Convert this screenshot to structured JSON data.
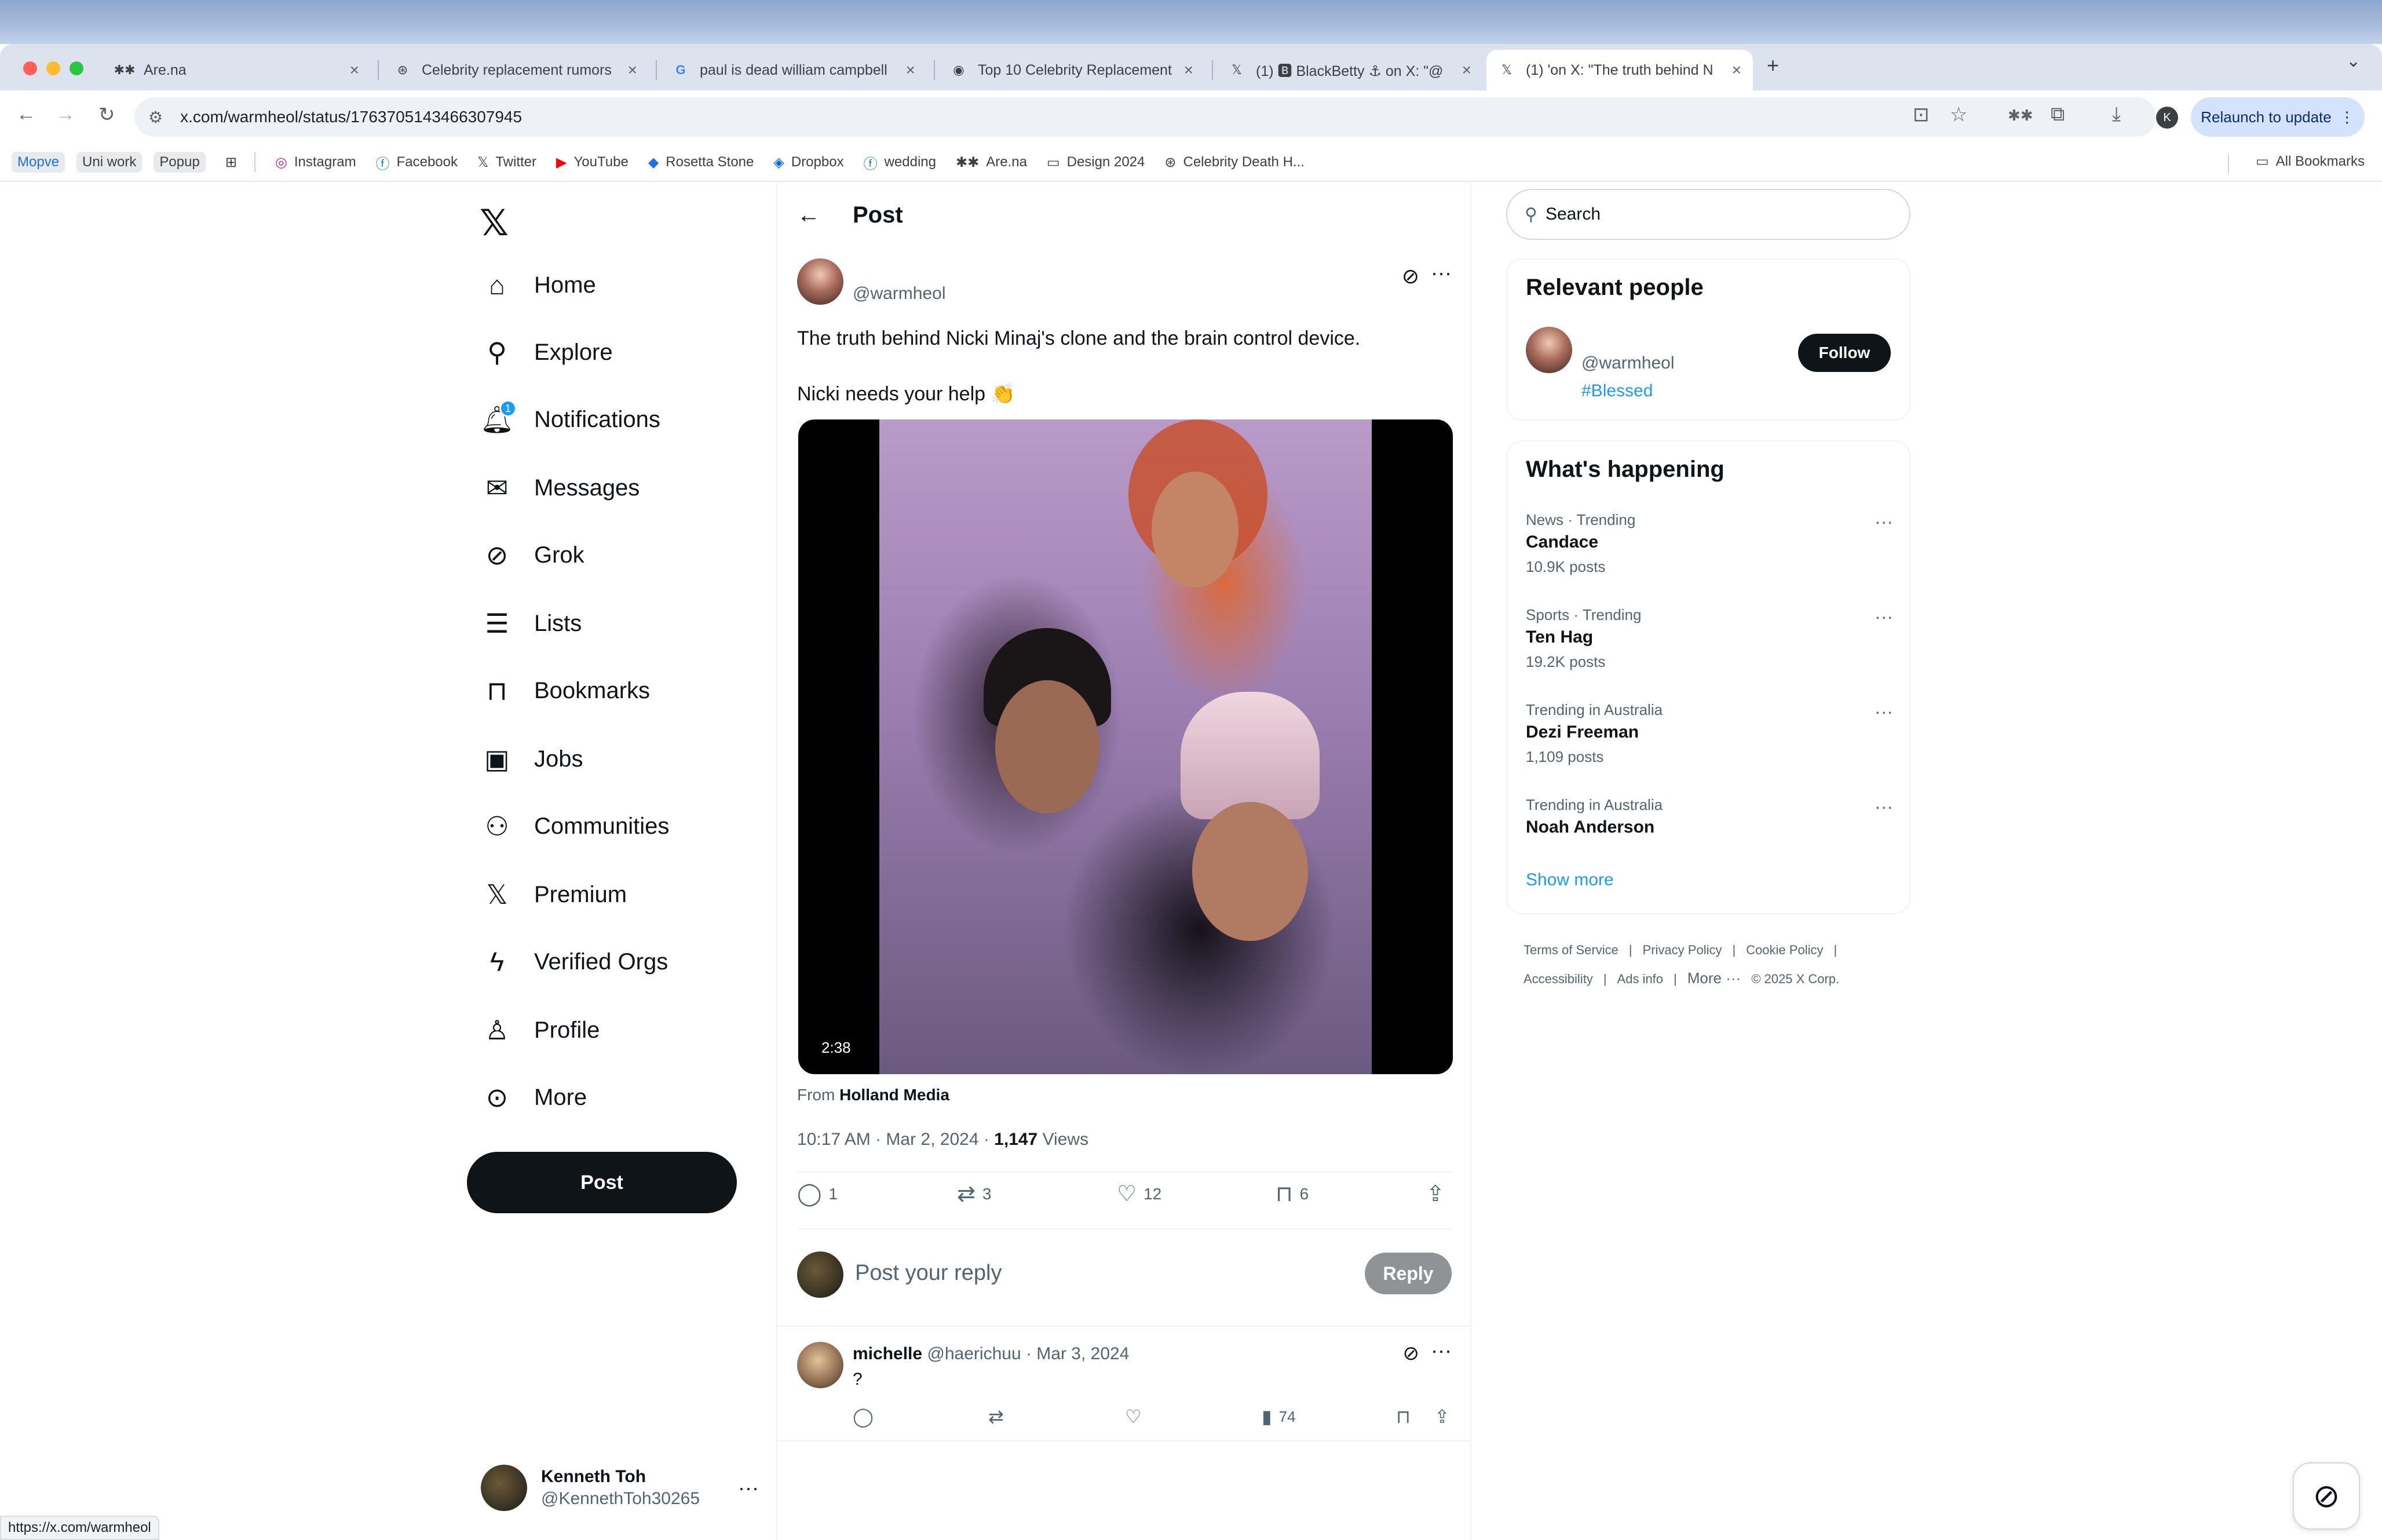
{
  "browser": {
    "tabs": [
      {
        "title": "Are.na",
        "icon": "arena-icon",
        "glyph": "✱✱"
      },
      {
        "title": "Celebrity replacement rumors",
        "icon": "chatgpt-icon",
        "glyph": "⊛"
      },
      {
        "title": "paul is dead william campbell",
        "icon": "google-icon",
        "glyph": "G"
      },
      {
        "title": "Top 10 Celebrity Replacement",
        "icon": "site-icon",
        "glyph": "◉"
      },
      {
        "title": "(1) 🅱 BlackBetty ⚓ on X: \"@",
        "icon": "x-icon",
        "glyph": "𝕏"
      },
      {
        "title": "(1) 'on X: \"The truth behind N",
        "icon": "x-icon",
        "glyph": "𝕏"
      }
    ],
    "url": "x.com/warmheol/status/1763705143466307945",
    "relaunch_label": "Relaunch to update",
    "profile_initial": "K",
    "bookmarks": [
      {
        "label": "Mopve",
        "icon": ""
      },
      {
        "label": "Uni work",
        "icon": ""
      },
      {
        "label": "Popup",
        "icon": ""
      },
      {
        "label": "Instagram",
        "icon": "◎"
      },
      {
        "label": "Facebook",
        "icon": "ⓕ"
      },
      {
        "label": "Twitter",
        "icon": "𝕏"
      },
      {
        "label": "YouTube",
        "icon": "▶"
      },
      {
        "label": "Rosetta Stone",
        "icon": "◆"
      },
      {
        "label": "Dropbox",
        "icon": "◈"
      },
      {
        "label": "wedding",
        "icon": "ⓕ"
      },
      {
        "label": "Are.na",
        "icon": "✱✱"
      },
      {
        "label": "Design 2024",
        "icon": "▭"
      },
      {
        "label": "Celebrity Death H...",
        "icon": "⊛"
      }
    ],
    "all_bookmarks": "All Bookmarks",
    "status_url": "https://x.com/warmheol"
  },
  "nav": {
    "items": [
      {
        "label": "Home",
        "icon": "home-icon"
      },
      {
        "label": "Explore",
        "icon": "search-icon"
      },
      {
        "label": "Notifications",
        "icon": "bell-icon",
        "badge": "1"
      },
      {
        "label": "Messages",
        "icon": "envelope-icon"
      },
      {
        "label": "Grok",
        "icon": "grok-icon"
      },
      {
        "label": "Lists",
        "icon": "list-icon"
      },
      {
        "label": "Bookmarks",
        "icon": "bookmark-icon"
      },
      {
        "label": "Jobs",
        "icon": "briefcase-icon"
      },
      {
        "label": "Communities",
        "icon": "people-icon"
      },
      {
        "label": "Premium",
        "icon": "x-logo-icon"
      },
      {
        "label": "Verified Orgs",
        "icon": "lightning-icon"
      },
      {
        "label": "Profile",
        "icon": "person-icon"
      },
      {
        "label": "More",
        "icon": "more-circle-icon"
      }
    ],
    "post_label": "Post",
    "account": {
      "name": "Kenneth Toh",
      "handle": "@KennethToh30265"
    }
  },
  "post": {
    "header_title": "Post",
    "author_handle": "@warmheol",
    "text_lines": [
      "The truth behind Nicki Minaj's clone and the brain control device.",
      "Nicki needs your help 👏"
    ],
    "video_duration": "2:38",
    "from_prefix": "From",
    "from_source": "Holland Media",
    "time": "10:17 AM · Mar 2, 2024 · ",
    "views_count": "1,147",
    "views_label": "Views",
    "stats": {
      "replies": "1",
      "reposts": "3",
      "likes": "12",
      "bookmarks": "6"
    },
    "reply_placeholder": "Post your reply",
    "reply_button": "Reply"
  },
  "reply": {
    "name": "michelle",
    "handle_date": "@haerichuu · Mar 3, 2024",
    "text": "?",
    "views": "74"
  },
  "sidebar": {
    "search_placeholder": "Search",
    "relevant_title": "Relevant people",
    "person": {
      "handle": "@warmheol",
      "tag": "#Blessed",
      "follow": "Follow"
    },
    "happening_title": "What's happening",
    "trends": [
      {
        "context": "News · Trending",
        "name": "Candace",
        "count": "10.9K posts"
      },
      {
        "context": "Sports · Trending",
        "name": "Ten Hag",
        "count": "19.2K posts"
      },
      {
        "context": "Trending in Australia",
        "name": "Dezi Freeman",
        "count": "1,109 posts"
      },
      {
        "context": "Trending in Australia",
        "name": "Noah Anderson",
        "count": ""
      }
    ],
    "show_more": "Show more",
    "footer": [
      "Terms of Service",
      "|",
      "Privacy Policy",
      "|",
      "Cookie Policy",
      "|",
      "Accessibility",
      "|",
      "Ads info",
      "|",
      "More ···",
      "© 2025 X Corp."
    ]
  }
}
